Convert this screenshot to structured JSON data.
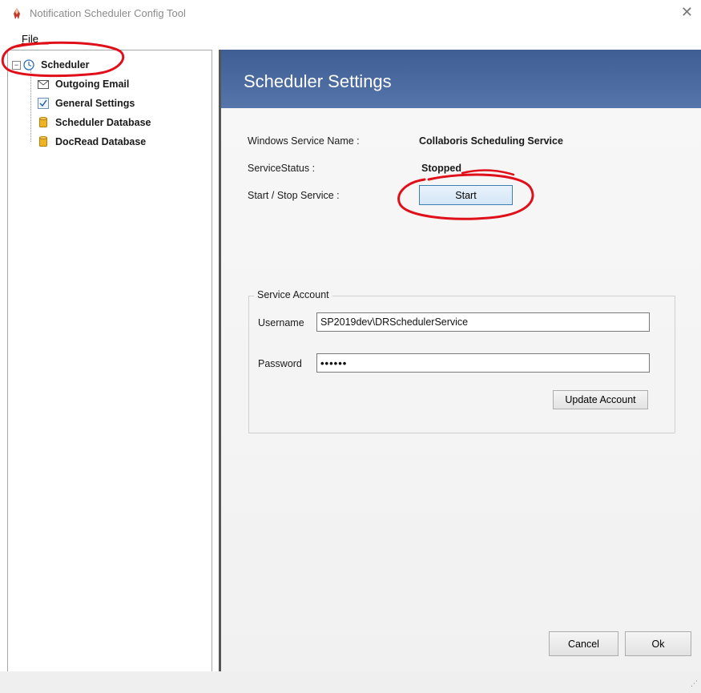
{
  "window": {
    "title": "Notification Scheduler Config Tool"
  },
  "menu": {
    "file": "File"
  },
  "tree": {
    "root": {
      "label": "Scheduler",
      "icon": "clock-icon",
      "expander": "⊟"
    },
    "children": [
      {
        "label": "Outgoing Email",
        "icon": "envelope-icon"
      },
      {
        "label": "General Settings",
        "icon": "checkbox-icon"
      },
      {
        "label": "Scheduler Database",
        "icon": "database-icon"
      },
      {
        "label": "DocRead Database",
        "icon": "database-icon"
      }
    ]
  },
  "panel": {
    "header": "Scheduler Settings",
    "service_name_label": "Windows Service Name :",
    "service_name_value": "Collaboris Scheduling Service",
    "service_status_label": "ServiceStatus :",
    "service_status_value": "Stopped",
    "start_stop_label": "Start / Stop Service :",
    "start_button": "Start",
    "account": {
      "group_title": "Service Account",
      "username_label": "Username",
      "username_value": "SP2019dev\\DRSchedulerService",
      "password_label": "Password",
      "password_value": "••••••",
      "update_button": "Update Account"
    }
  },
  "footer": {
    "cancel": "Cancel",
    "ok": "Ok"
  },
  "colors": {
    "header_band": "#4a6aa0",
    "annotation": "#e0101a",
    "start_border": "#3c7fb1"
  }
}
